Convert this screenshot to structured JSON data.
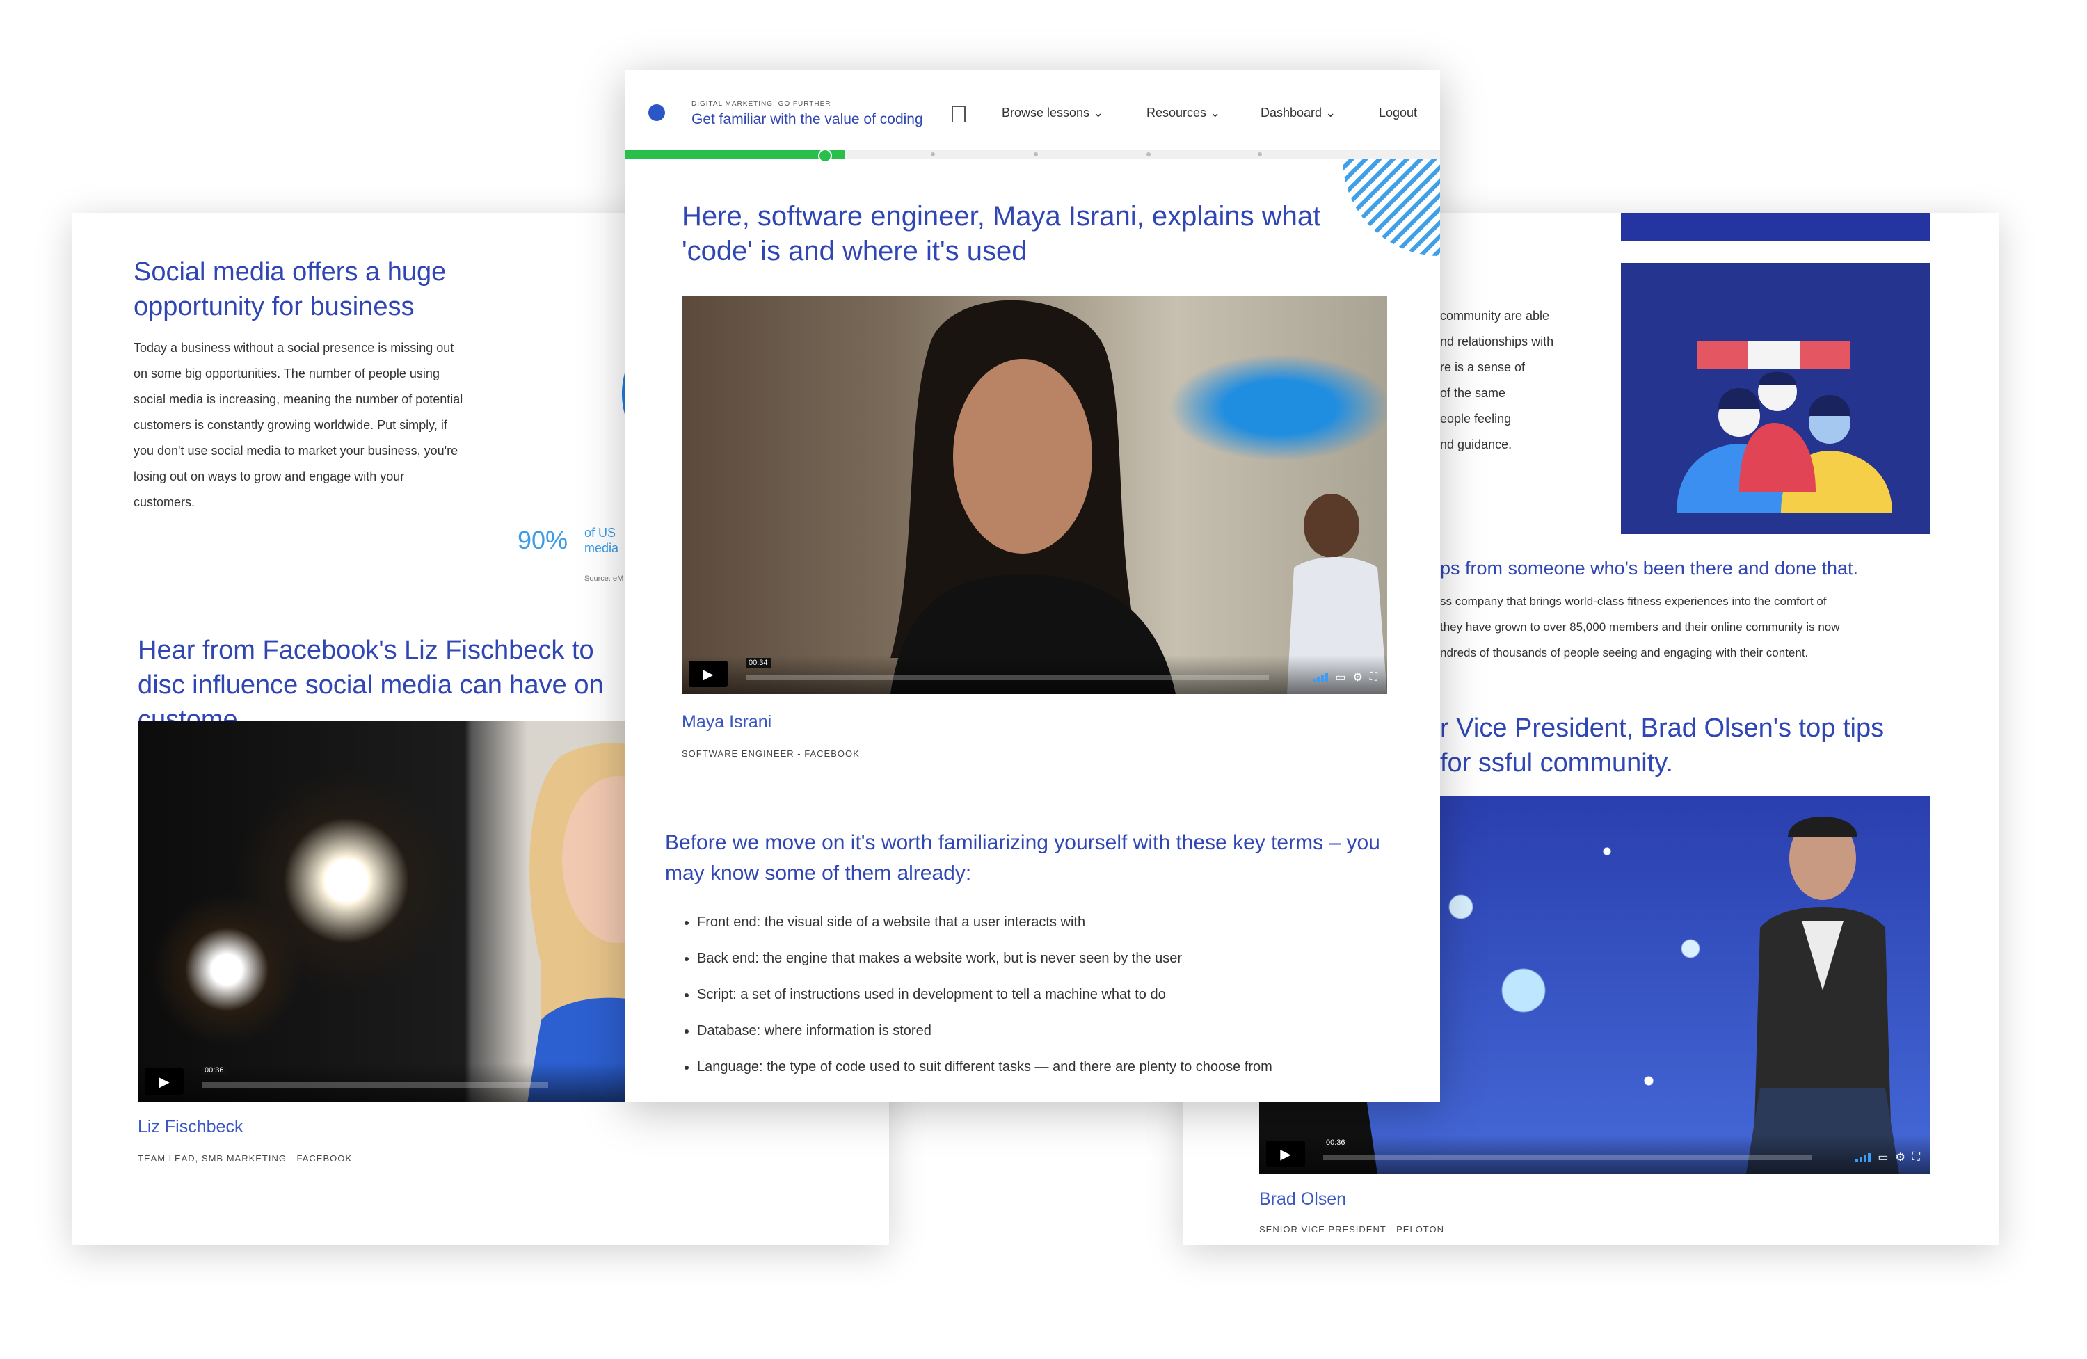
{
  "left_card": {
    "heading": "Social media offers a huge opportunity for business",
    "paragraph": "Today a business without a social presence is missing out on some big opportunities. The number of people using social media is increasing, meaning the number of potential customers is constantly growing worldwide. Put simply, if you don't use social media to market your business, you're losing out on ways to grow and engage with your customers.",
    "stat_value": "90%",
    "stat_text": "of US",
    "stat_text2": "media",
    "stat_source": "Source: eM",
    "video_heading": "Hear from Facebook's Liz Fischbeck to disc influence social media can have on custome",
    "video_time": "00:36",
    "person_name": "Liz Fischbeck",
    "person_role": "TEAM LEAD, SMB MARKETING - FACEBOOK"
  },
  "center_card": {
    "eyebrow": "DIGITAL MARKETING: GO FURTHER",
    "course_title": "Get familiar with the value of coding",
    "nav": [
      "Browse lessons",
      "Resources",
      "Dashboard",
      "Logout"
    ],
    "progress": 0.27,
    "heading": "Here, software engineer, Maya Israni, explains what 'code' is and where it's used",
    "video_time": "00:34",
    "person_name": "Maya Israni",
    "person_role": "SOFTWARE ENGINEER - FACEBOOK",
    "terms_heading": "Before we move on it's worth familiarizing yourself with these key terms – you may know some of them already:",
    "terms": [
      "Front end: the visual side of a website that a user interacts with",
      "Back end: the engine that makes a website work, but is never seen by the user",
      "Script: a set of instructions used in development to tell a machine what to do",
      "Database: where information is stored",
      "Language: the type of code used to suit different tasks — and there are plenty to choose from"
    ]
  },
  "right_card": {
    "paragraph_lines": [
      "community are able",
      "nd relationships with",
      "re is a sense of",
      "of the same",
      "eople feeling",
      "nd guidance."
    ],
    "tips_heading": "ps from someone who's been there and done that.",
    "tips_lines": [
      "ss company that brings world-class fitness experiences into the comfort of",
      "they have grown to over 85,000 members and their online community is now",
      "ndreds of thousands of people seeing and engaging with their content."
    ],
    "video_heading": "r Vice President, Brad Olsen's top tips for ssful community.",
    "video_time": "00:36",
    "person_name": "Brad Olsen",
    "person_role": "SENIOR VICE PRESIDENT - PELOTON"
  }
}
